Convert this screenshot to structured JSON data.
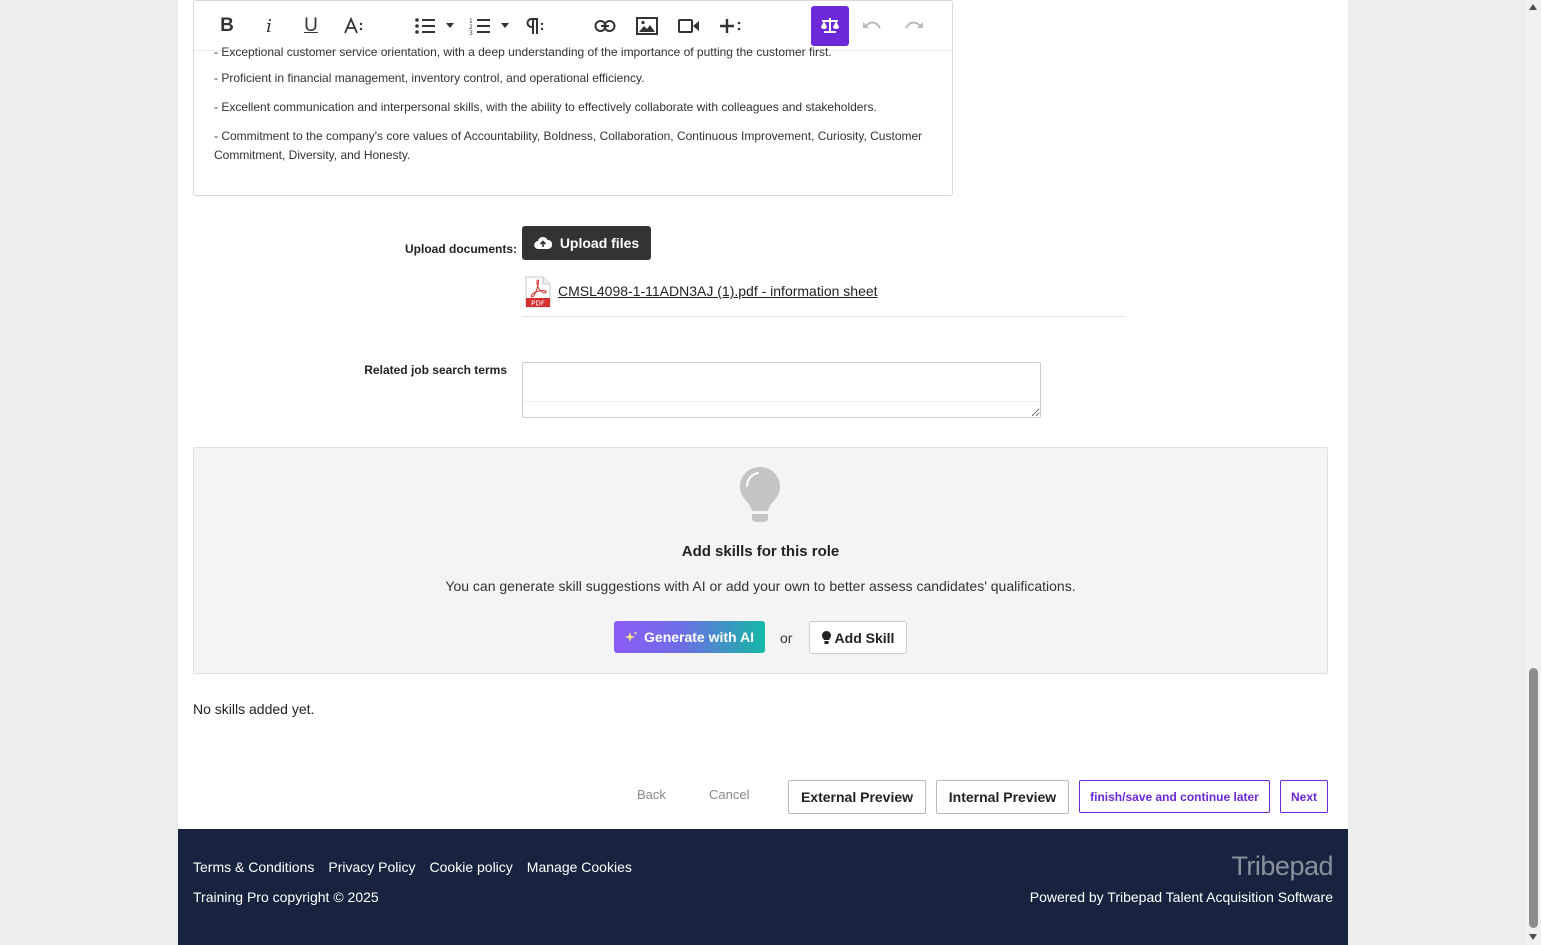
{
  "editor": {
    "paragraphs": [
      "- Exceptional customer service orientation, with a deep understanding of the importance of putting the customer first.",
      "- Proficient in financial management, inventory control, and operational efficiency.",
      "- Excellent communication and interpersonal skills, with the ability to effectively collaborate with colleagues and stakeholders.",
      "- Commitment to the company's core values of Accountability, Boldness, Collaboration, Continuous Improvement, Curiosity, Customer Commitment, Diversity, and Honesty."
    ],
    "toolbar": {
      "bold": "B",
      "italic": "i",
      "underline": "U",
      "active_color": "#6d28d9"
    }
  },
  "upload": {
    "label": "Upload documents:",
    "button_label": "Upload files",
    "file_name": "CMSL4098-1-11ADN3AJ (1).pdf - information sheet",
    "pdf_badge": "PDF"
  },
  "search_terms": {
    "label": "Related job search terms",
    "value": ""
  },
  "skills": {
    "title": "Add skills for this role",
    "description": "You can generate skill suggestions with AI or add your own to better assess candidates' qualifications.",
    "generate_label": "Generate with AI",
    "or_text": "or",
    "add_skill_label": "Add Skill",
    "empty_text": "No skills added yet."
  },
  "actions": {
    "back": "Back",
    "cancel": "Cancel",
    "external_preview": "External Preview",
    "internal_preview": "Internal Preview",
    "finish_save": "finish/save and continue later",
    "next": "Next"
  },
  "footer": {
    "links": [
      "Terms & Conditions",
      "Privacy Policy",
      "Cookie policy",
      "Manage Cookies"
    ],
    "copyright": "Training Pro copyright © 2025",
    "brand": "Tribepad",
    "powered_by": "Powered by Tribepad Talent Acquisition Software",
    "background": "#17233f"
  }
}
